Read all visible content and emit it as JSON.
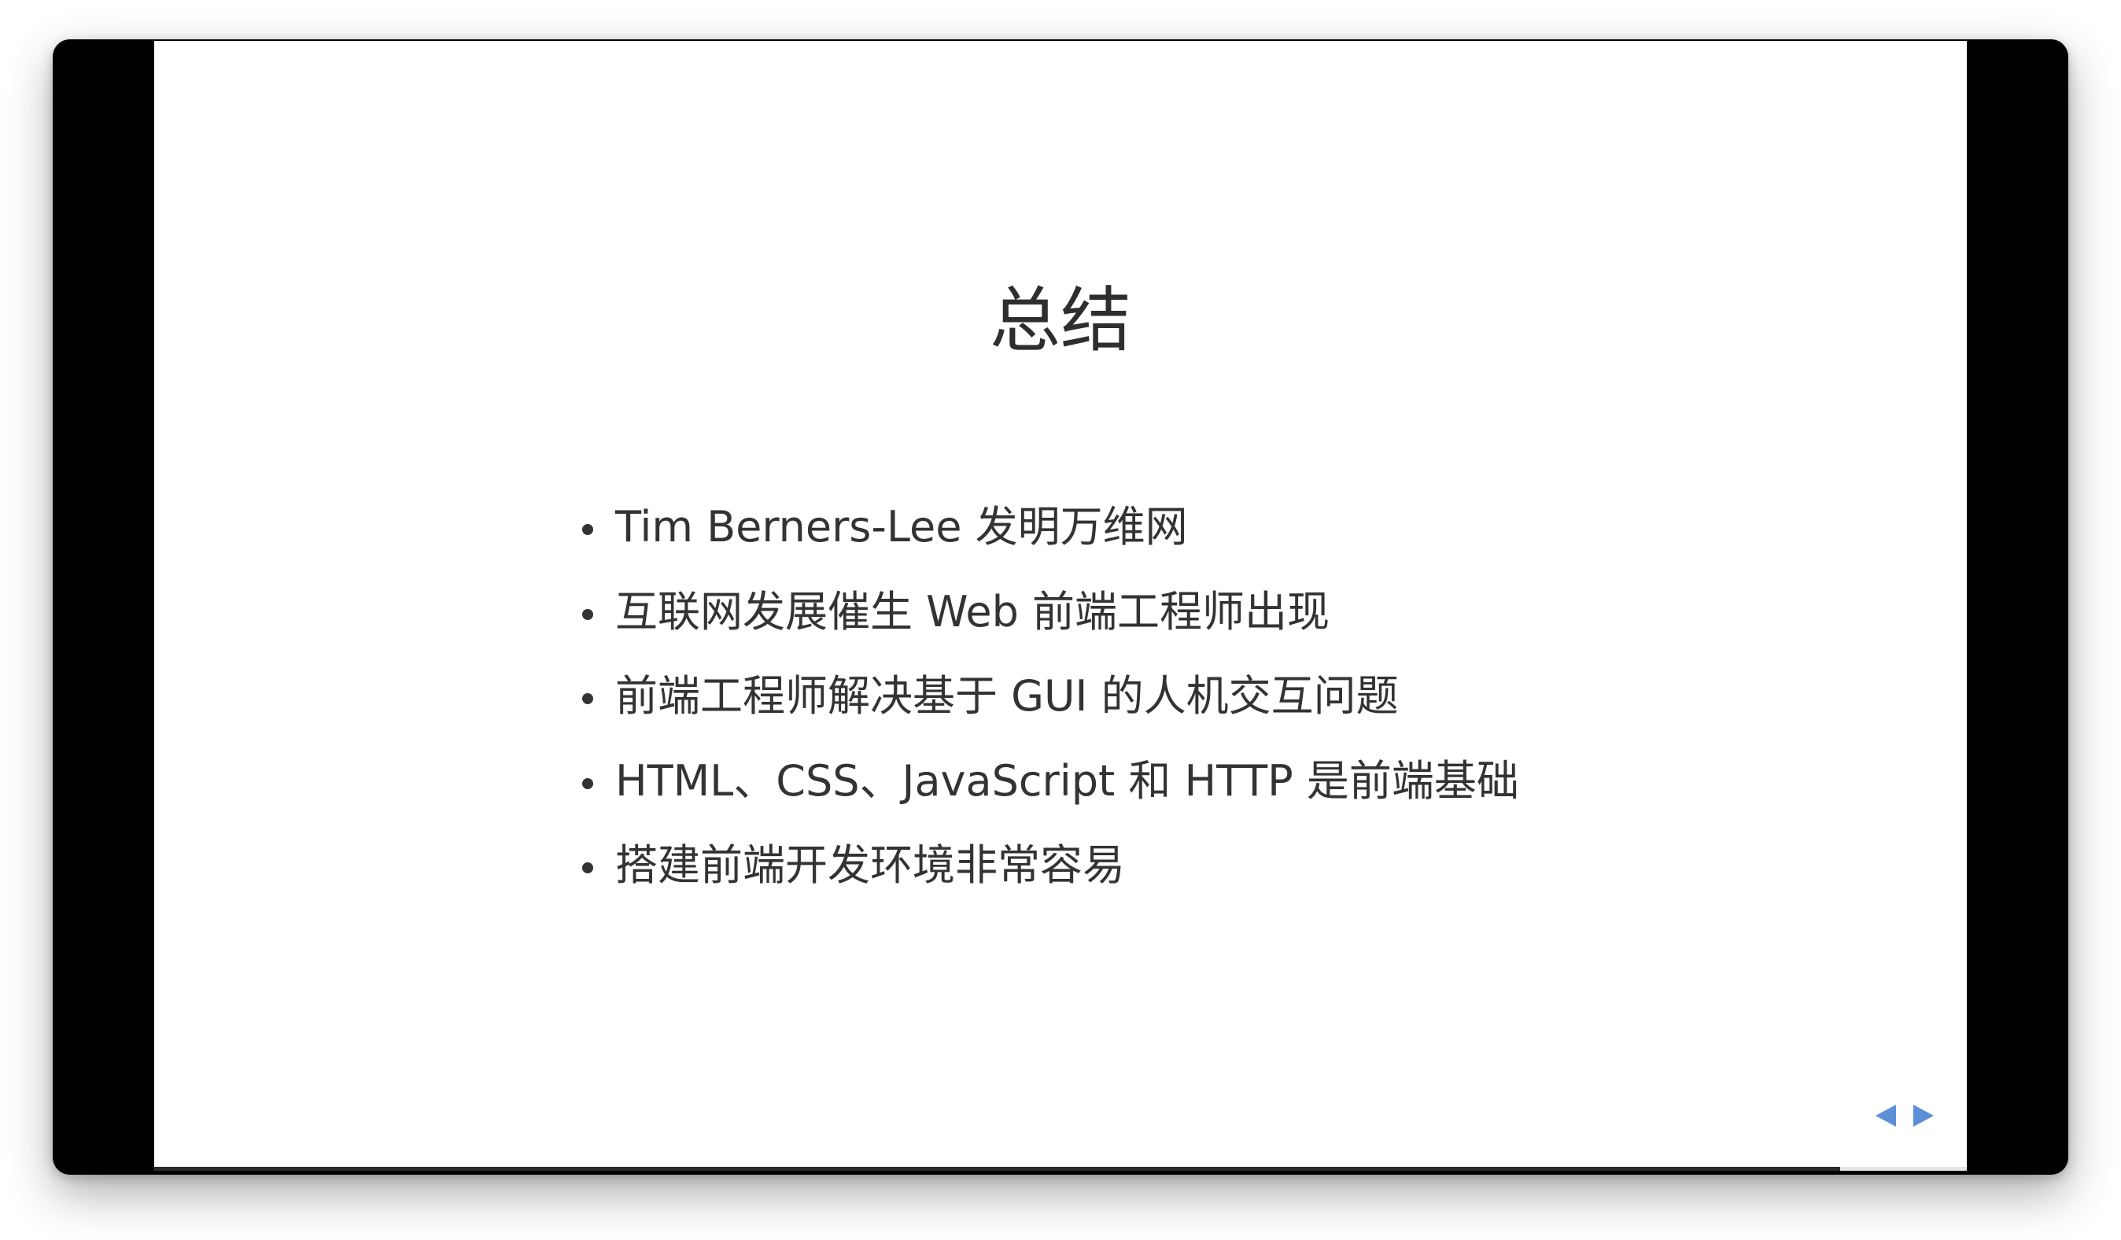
{
  "slide": {
    "title": "总结",
    "bullets": [
      "Tim Berners-Lee 发明万维网",
      "互联网发展催生 Web 前端工程师出现",
      "前端工程师解决基于 GUI 的人机交互问题",
      "HTML、CSS、JavaScript 和 HTTP 是前端基础",
      "搭建前端开发环境非常容易"
    ]
  },
  "navigation": {
    "prev_icon": "triangle-left-icon",
    "next_icon": "triangle-right-icon",
    "color": "#5b8fd6"
  },
  "progress": {
    "fraction": 0.93
  },
  "colors": {
    "frame": "#000000",
    "slide_bg": "#ffffff",
    "text": "#333333"
  }
}
